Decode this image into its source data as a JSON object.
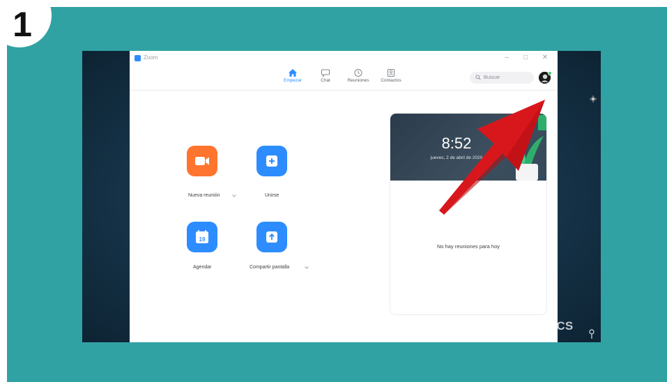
{
  "step": {
    "number": "1"
  },
  "window": {
    "title": "Zoom",
    "minimize_icon": "minimize-icon",
    "maximize_icon": "maximize-icon",
    "close_icon": "close-icon"
  },
  "nav": {
    "tabs": [
      {
        "label": "Empezar",
        "icon": "home-icon",
        "active": true
      },
      {
        "label": "Chat",
        "icon": "chat-icon",
        "active": false
      },
      {
        "label": "Reuniones",
        "icon": "clock-icon",
        "active": false
      },
      {
        "label": "Contactos",
        "icon": "contacts-icon",
        "active": false
      }
    ],
    "search": {
      "placeholder": "Buscar"
    }
  },
  "actions": [
    {
      "label": "Nueva reunión",
      "icon": "video-camera-icon",
      "color": "#ff742e"
    },
    {
      "label": "Unirse",
      "icon": "plus-icon",
      "color": "#2d8cff"
    },
    {
      "label": "Agendar",
      "icon": "calendar-icon",
      "color": "#2d8cff",
      "calendar_day": "19"
    },
    {
      "label": "Compartir pantalla",
      "icon": "share-screen-icon",
      "color": "#2d8cff"
    }
  ],
  "calendar_card": {
    "time": "8:52",
    "date": "jueves, 2 de abril de 2020",
    "empty_message": "No hay reuniones para hoy"
  },
  "watermark": {
    "text": "XATAKA BASICS"
  },
  "colors": {
    "frame": "#31a2a4",
    "accent_blue": "#2d8cff",
    "accent_orange": "#ff742e",
    "arrow": "#e8262a"
  }
}
